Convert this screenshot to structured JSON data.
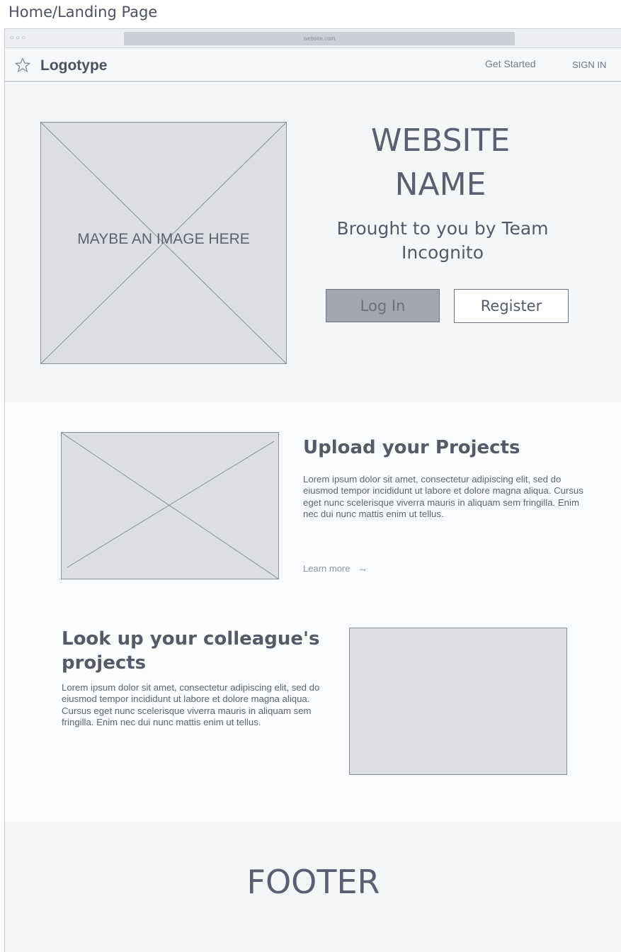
{
  "page_label": "Home/Landing Page",
  "browser": {
    "traffic_lights": "○○○",
    "url": "website.com"
  },
  "navbar": {
    "logo_icon": "star-outline-icon",
    "logotype": "Logotype",
    "get_started": "Get Started",
    "sign_in": "SIGN IN"
  },
  "hero": {
    "image_placeholder": "MAYBE AN IMAGE HERE",
    "site_name_line1": "WEBSITE",
    "site_name_line2": "NAME",
    "subtitle_line1": "Brought to you by Team",
    "subtitle_line2": "Incognito",
    "login_label": "Log In",
    "register_label": "Register"
  },
  "features": [
    {
      "title": "Upload your Projects",
      "text": "Lorem ipsum dolor sit amet, consectetur adipiscing elit, sed do eiusmod tempor incididunt ut labore et dolore magna aliqua. Cursus eget nunc scelerisque viverra mauris in aliquam sem fringilla. Enim nec dui nunc mattis enim ut tellus.",
      "learn_more": "Learn more",
      "arrow_icon": "→"
    },
    {
      "title": "Look up your colleague's projects",
      "text": "Lorem ipsum dolor sit amet, consectetur adipiscing elit, sed do eiusmod tempor incididunt ut labore et dolore magna aliqua. Cursus eget nunc scelerisque viverra mauris in aliquam sem fringilla. Enim nec dui nunc mattis enim ut tellus."
    }
  ],
  "footer": {
    "label": "FOOTER"
  }
}
